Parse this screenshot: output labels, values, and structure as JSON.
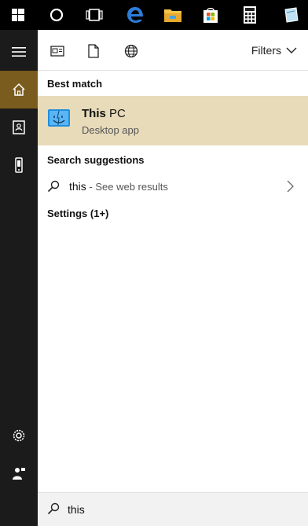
{
  "taskbar": {
    "icons": [
      "windows-start-icon",
      "cortana-circle-icon",
      "task-view-icon",
      "edge-icon",
      "file-explorer-icon",
      "store-icon",
      "calculator-icon",
      "sticky-app-icon"
    ]
  },
  "sidebar": {
    "items": [
      "hamburger-menu-icon",
      "home-icon",
      "notebook-icon",
      "devices-icon",
      "settings-icon",
      "feedback-icon"
    ]
  },
  "toolbar": {
    "filters_label": "Filters"
  },
  "sections": {
    "best_match": "Best match",
    "search_suggestions": "Search suggestions",
    "settings": "Settings (1+)"
  },
  "best_match_item": {
    "title_bold": "This",
    "title_rest": " PC",
    "subtitle": "Desktop app"
  },
  "suggestion": {
    "query": "this",
    "suffix": " - See web results"
  },
  "search": {
    "value": "this"
  },
  "colors": {
    "accent": "#7a5c1e",
    "highlight": "#e8dbba"
  }
}
